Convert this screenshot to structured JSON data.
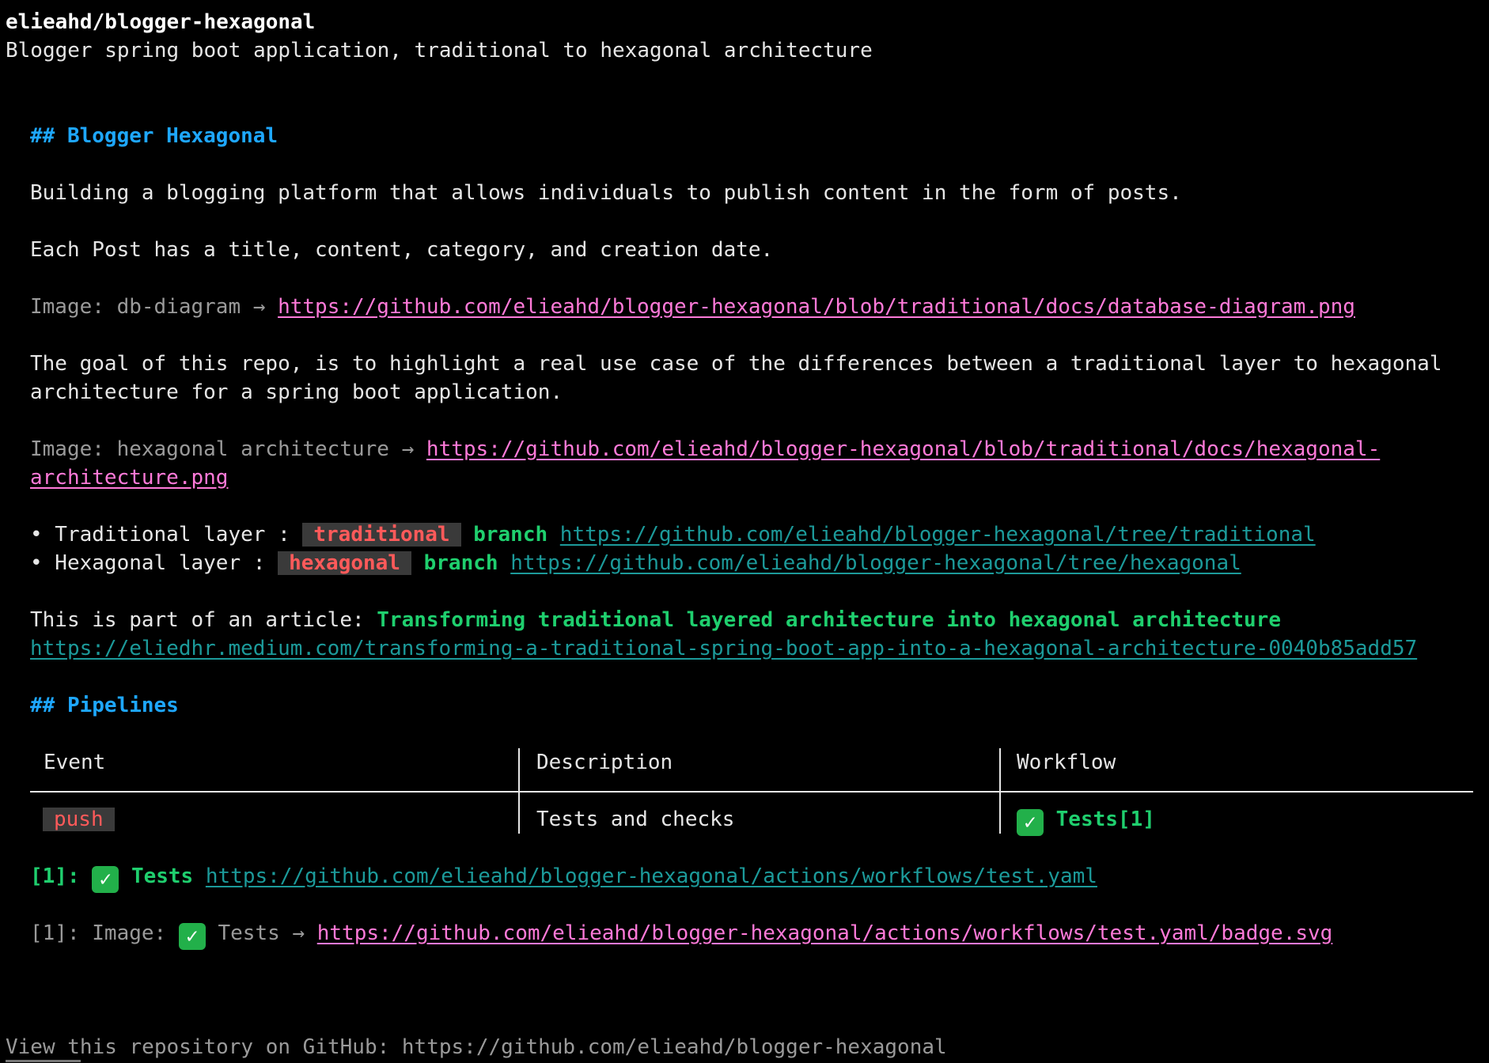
{
  "repo": {
    "name": "elieahd/blogger-hexagonal",
    "description": "Blogger spring boot application, traditional to hexagonal architecture"
  },
  "readme": {
    "h1": "## Blogger Hexagonal",
    "p1": "Building a blogging platform that allows individuals to publish content in the form of posts.",
    "p2": "Each Post has a title, content, category, and creation date.",
    "img1_label": "Image: db-diagram →",
    "img1_url": "https://github.com/elieahd/blogger-hexagonal/blob/traditional/docs/database-diagram.png",
    "p3_line1": "The goal of this repo, is to highlight a real use case of the differences between a traditional layer to hexagonal",
    "p3_line2": "architecture for a spring boot application.",
    "img2_label": "Image: hexagonal architecture →",
    "img2_url_line1": "https://github.com/elieahd/blogger-hexagonal/blob/traditional/docs/hexagonal-",
    "img2_url_line2": "architecture.png",
    "bullets": [
      {
        "prefix": "• Traditional layer : ",
        "code": "traditional",
        "branch": "branch",
        "url": "https://github.com/elieahd/blogger-hexagonal/tree/traditional"
      },
      {
        "prefix": "• Hexagonal layer : ",
        "code": "hexagonal",
        "branch": "branch",
        "url": "https://github.com/elieahd/blogger-hexagonal/tree/hexagonal"
      }
    ],
    "article_prefix": "This is part of an article: ",
    "article_title": "Transforming traditional layered architecture into hexagonal architecture",
    "article_url": "https://eliedhr.medium.com/transforming-a-traditional-spring-boot-app-into-a-hexagonal-architecture-0040b85add57",
    "h2": "## Pipelines",
    "table": {
      "headers": [
        "Event",
        "Description",
        "Workflow"
      ],
      "rows": [
        {
          "event": "push",
          "description": "Tests and checks",
          "workflow": "Tests[1]"
        }
      ]
    },
    "ref1_prefix": "[1]:",
    "ref1_label": "Tests",
    "ref1_url": "https://github.com/elieahd/blogger-hexagonal/actions/workflows/test.yaml",
    "ref2_prefix": "[1]: Image:",
    "ref2_label": "Tests →",
    "ref2_url": "https://github.com/elieahd/blogger-hexagonal/actions/workflows/test.yaml/badge.svg",
    "check_glyph": "✓"
  },
  "footer": {
    "text": "View this repository on GitHub: https://github.com/elieahd/blogger-hexagonal"
  },
  "colors": {
    "background": "#000000",
    "heading": "#1ea7ff",
    "link_pink": "#ff7ad9",
    "link_teal": "#1c9a9a",
    "green": "#1fcf6e",
    "code_red": "#ff5a5a",
    "check_green": "#22b04a"
  }
}
